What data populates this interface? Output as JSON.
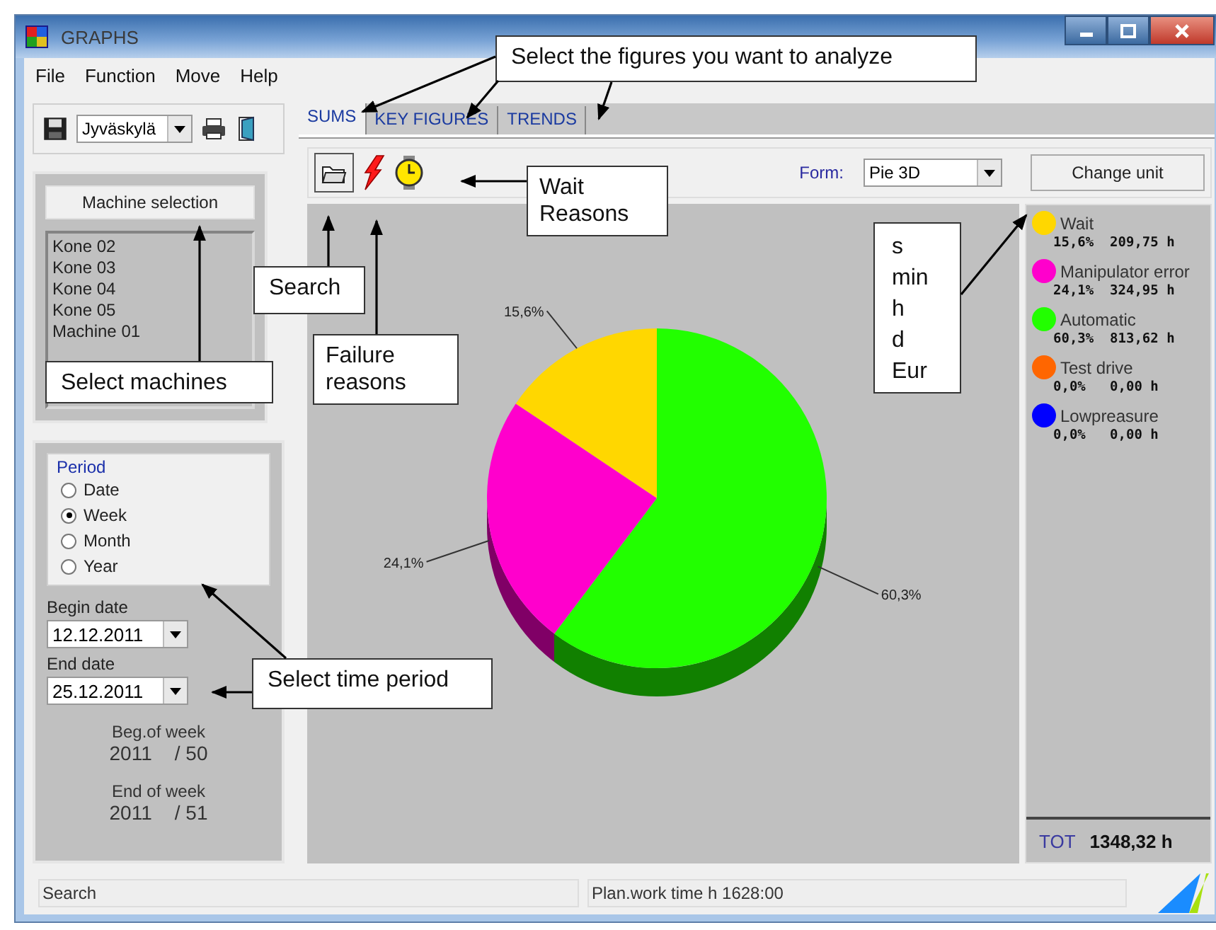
{
  "window": {
    "title": "GRAPHS"
  },
  "menu": [
    {
      "label": "File"
    },
    {
      "label": "Function"
    },
    {
      "label": "Move"
    },
    {
      "label": "Help"
    }
  ],
  "left_toolbar": {
    "location": "Jyväskylä"
  },
  "machines": {
    "button": "Machine selection",
    "items": [
      "Kone 02",
      "Kone 03",
      "Kone 04",
      "Kone 05",
      "Machine 01"
    ]
  },
  "period": {
    "title": "Period",
    "options": [
      {
        "label": "Date",
        "selected": false
      },
      {
        "label": "Week",
        "selected": true
      },
      {
        "label": "Month",
        "selected": false
      },
      {
        "label": "Year",
        "selected": false
      }
    ]
  },
  "dates": [
    {
      "label": "Begin date",
      "value": "12.12.2011"
    },
    {
      "label": "End date",
      "value": "25.12.2011"
    }
  ],
  "weeks": [
    {
      "label": "Beg.of week",
      "year": "2011",
      "week": "/ 50"
    },
    {
      "label": "End of week",
      "year": "2011",
      "week": "/ 51"
    }
  ],
  "tabs": [
    {
      "label": "SUMS",
      "selected": true
    },
    {
      "label": "KEY FIGURES",
      "selected": false
    },
    {
      "label": "TRENDS",
      "selected": false
    }
  ],
  "form": {
    "label": "Form:",
    "value": "Pie 3D"
  },
  "change_unit": "Change unit",
  "chart_data": {
    "type": "pie",
    "categories": [
      "Wait",
      "Manipulator error",
      "Automatic"
    ],
    "values": [
      15.6,
      24.1,
      60.3
    ],
    "value_labels": [
      "15,6%",
      "24,1%",
      "60,3%"
    ]
  },
  "legend": [
    {
      "color": "#ffd700",
      "stats": "15,6%  209,75 h"
    },
    {
      "color": "#ff00cc",
      "stats": "24,1%  324,95 h"
    },
    {
      "color": "#22ff00",
      "stats": "60,3%  813,62 h"
    },
    {
      "name": "Test drive",
      "color": "#ff6600",
      "stats": "0,0%   0,00 h"
    },
    {
      "name": "Lowpreasure",
      "color": "#0000ff",
      "stats": "0,0%   0,00 h"
    }
  ],
  "total": {
    "label": "TOT",
    "value": "1348,32 h"
  },
  "status_bar": [
    "Search",
    "Plan.work time h 1628:00"
  ],
  "annotations": [
    {
      "text": "Select the figures you want to analyze"
    },
    {
      "text": "Wait\nReasons"
    },
    {
      "text": "Search"
    },
    {
      "text": "Select machines"
    },
    {
      "text": "Failure\nreasons"
    },
    {
      "text": "s\nmin\nh\nd\nEur"
    },
    {
      "text": "Select time period"
    }
  ]
}
